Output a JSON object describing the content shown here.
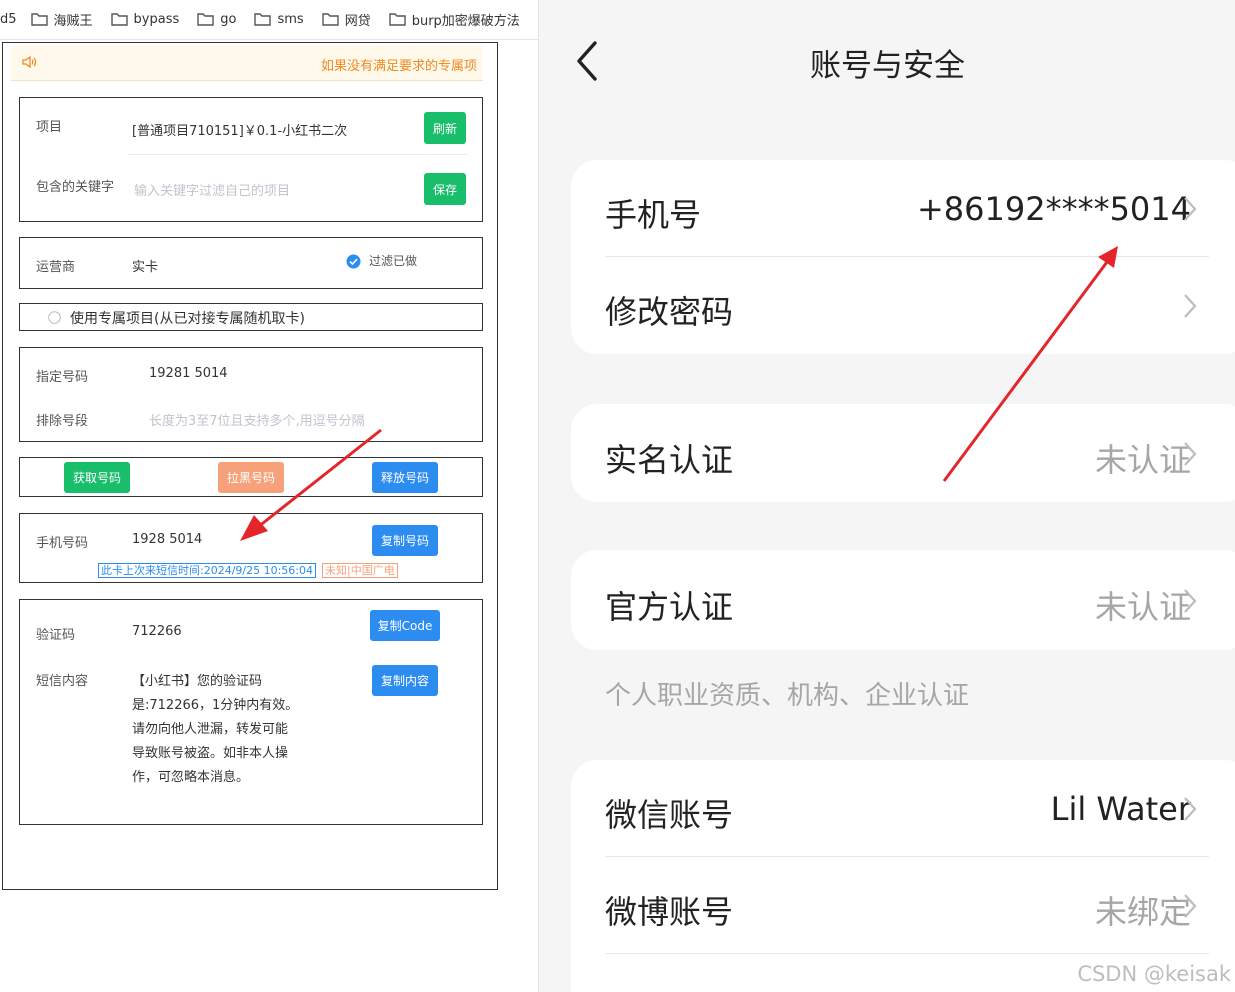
{
  "bookmarks": [
    "d5",
    "海贼王",
    "bypass",
    "go",
    "sms",
    "网贷",
    "burp加密爆破方法"
  ],
  "left": {
    "notice": "如果没有满足要求的专属项",
    "project": {
      "label": "项目",
      "value": "[普通项目710151]￥0.1-小红书二次",
      "refresh": "刷新",
      "keyword_label": "包含的关键字",
      "keyword_placeholder": "输入关键字过滤自己的项目",
      "save": "保存"
    },
    "operator": {
      "label": "运营商",
      "value": "实卡",
      "filter_label": "过滤已做"
    },
    "exclusive": {
      "label": "使用专属项目(从已对接专属随机取卡)"
    },
    "number": {
      "label": "指定号码",
      "value": "19281 5014",
      "exclude_label": "排除号段",
      "exclude_placeholder": "长度为3至7位且支持多个,用逗号分隔"
    },
    "actions": {
      "get": "获取号码",
      "blacklist": "拉黑号码",
      "release": "释放号码"
    },
    "phone": {
      "label": "手机号码",
      "value": "1928 5014",
      "copy": "复制号码",
      "last_sms_tag": "此卡上次来短信时间:2024/9/25 10:56:04",
      "carrier_tag": "未知|中国广电"
    },
    "code": {
      "label": "验证码",
      "value": "712266",
      "copy_code": "复制Code",
      "sms_label": "短信内容",
      "copy_content": "复制内容",
      "sms_lines": [
        "【小红书】您的验证码",
        "是:712266，1分钟内有效。",
        "请勿向他人泄漏，转发可能",
        "导致账号被盗。如非本人操",
        "作，可忽略本消息。"
      ]
    }
  },
  "right": {
    "title": "账号与安全",
    "rows": {
      "phone_label": "手机号",
      "phone_value": "+86192****5014",
      "password_label": "修改密码",
      "realname_label": "实名认证",
      "realname_value": "未认证",
      "official_label": "官方认证",
      "official_value": "未认证",
      "official_hint": "个人职业资质、机构、企业认证",
      "wechat_label": "微信账号",
      "wechat_value": "Lil Water",
      "weibo_label": "微博账号",
      "weibo_value": "未绑定"
    },
    "watermark": "CSDN @keisak"
  },
  "colors": {
    "green": "#19be6b",
    "blue": "#2d8cf0",
    "orange": "#f6a17a",
    "arrow": "#e4262c"
  }
}
